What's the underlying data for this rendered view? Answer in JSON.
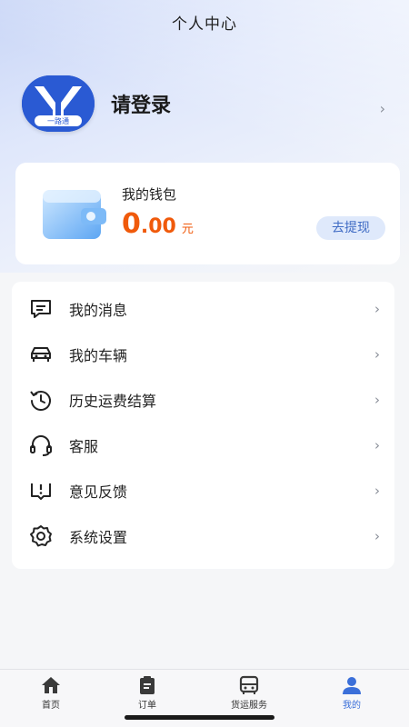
{
  "header": {
    "title": "个人中心"
  },
  "profile": {
    "login_text": "请登录",
    "logo_caption": "一路通",
    "arrow": "›"
  },
  "wallet": {
    "label": "我的钱包",
    "amount_int": "0",
    "amount_dec": ".00",
    "unit": "元",
    "withdraw_label": "去提现"
  },
  "menu": {
    "items": [
      {
        "label": "我的消息",
        "icon": "message-icon"
      },
      {
        "label": "我的车辆",
        "icon": "car-icon"
      },
      {
        "label": "历史运费结算",
        "icon": "history-icon"
      },
      {
        "label": "客服",
        "icon": "headset-icon"
      },
      {
        "label": "意见反馈",
        "icon": "feedback-icon"
      },
      {
        "label": "系统设置",
        "icon": "settings-icon"
      }
    ],
    "arrow": "›"
  },
  "tabbar": {
    "tabs": [
      {
        "label": "首页",
        "icon": "home-icon"
      },
      {
        "label": "订单",
        "icon": "clipboard-icon"
      },
      {
        "label": "货运服务",
        "icon": "bus-icon"
      },
      {
        "label": "我的",
        "icon": "user-icon",
        "active": true
      }
    ],
    "active_color": "#3b6fd9"
  },
  "colors": {
    "accent": "#f05a0b",
    "brand": "#2a5ad3"
  }
}
